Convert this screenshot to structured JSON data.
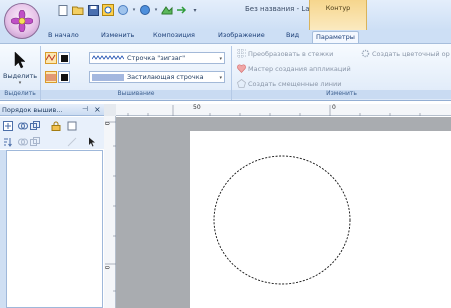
{
  "window": {
    "title": "Без названия - Layout & E...",
    "context_group": "Контур"
  },
  "tabs": [
    {
      "label": "В начало"
    },
    {
      "label": "Изменить"
    },
    {
      "label": "Композиция"
    },
    {
      "label": "Изображение"
    },
    {
      "label": "Вид"
    },
    {
      "label": "Параметры"
    }
  ],
  "active_tab": "Параметры",
  "ribbon": {
    "select": {
      "label": "Выделить",
      "group": "Выделить"
    },
    "sewing": {
      "group": "Вышивание",
      "outline_combo": "Строчка \"зигзаг\"",
      "fill_combo": "Застилающая строчка"
    },
    "change": {
      "group": "Изменить",
      "convert_label": "Преобразовать в стежки",
      "appliqué_label": "Мастер создания аппликаций",
      "offset_label": "Создать смещенные линии",
      "flower_label": "Создать цветочный ор"
    }
  },
  "panel": {
    "title": "Порядок вышив...",
    "pin": "ᵖ",
    "close": "×"
  },
  "ruler": {
    "h_labels": [
      "50",
      "0"
    ],
    "v_labels": [
      "0",
      "0"
    ]
  },
  "colors": {
    "accent": "#cddff5",
    "context_tab": "#f6d68d",
    "canvas": "#a9acb0"
  }
}
